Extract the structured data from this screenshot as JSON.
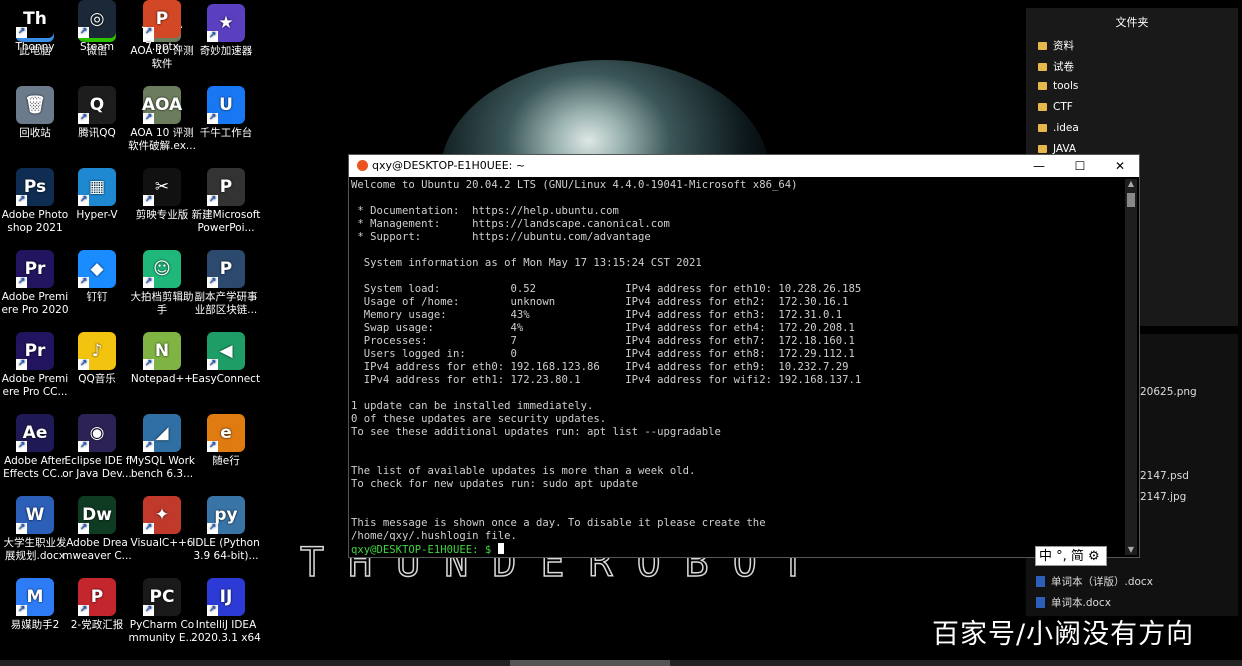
{
  "desktop": {
    "wallpaper_text": "THUNDEROBOT",
    "icons": [
      {
        "label": "此电脑",
        "glyph": "🖥",
        "color": "#3a8ee6"
      },
      {
        "label": "微信",
        "glyph": "●",
        "color": "#2dc100"
      },
      {
        "label": "AOA 10 评测软件",
        "glyph": "AOA",
        "color": "#6c7d5e"
      },
      {
        "label": "奇妙加速器",
        "glyph": "★",
        "color": "#5a3fc0"
      },
      {
        "label": "回收站",
        "glyph": "🗑",
        "color": "#6b7b8c"
      },
      {
        "label": "腾讯QQ",
        "glyph": "Q",
        "color": "#1d1d1d"
      },
      {
        "label": "AOA 10 评测软件破解.ex...",
        "glyph": "AOA",
        "color": "#6c7d5e"
      },
      {
        "label": "千牛工作台",
        "glyph": "U",
        "color": "#1877f2"
      },
      {
        "label": "Adobe Photoshop 2021",
        "glyph": "Ps",
        "color": "#0f2d52"
      },
      {
        "label": "Hyper-V",
        "glyph": "▦",
        "color": "#1e88d1"
      },
      {
        "label": "剪映专业版",
        "glyph": "✂",
        "color": "#111111"
      },
      {
        "label": "新建Microsoft PowerPoi...",
        "glyph": "P",
        "color": "#333333"
      },
      {
        "label": "Adobe Premiere Pro 2020",
        "glyph": "Pr",
        "color": "#22145e"
      },
      {
        "label": "钉钉",
        "glyph": "◆",
        "color": "#1a8cff"
      },
      {
        "label": "大拍档剪辑助手",
        "glyph": "☺",
        "color": "#1fb77a"
      },
      {
        "label": "副本产学研事业部区块链...",
        "glyph": "P",
        "color": "#2b4a6e"
      },
      {
        "label": "Adobe Premiere Pro CC...",
        "glyph": "Pr",
        "color": "#22145e"
      },
      {
        "label": "QQ音乐",
        "glyph": "♪",
        "color": "#f2c40f"
      },
      {
        "label": "Notepad++",
        "glyph": "N",
        "color": "#7fb343"
      },
      {
        "label": "EasyConnect",
        "glyph": "◀",
        "color": "#1e9e66"
      },
      {
        "label": "Adobe After Effects CC...",
        "glyph": "Ae",
        "color": "#1f1a55"
      },
      {
        "label": "Eclipse IDE for Java Dev...",
        "glyph": "◉",
        "color": "#2c2255"
      },
      {
        "label": "MySQL Workbench 6.3...",
        "glyph": "◢",
        "color": "#2f6fa3"
      },
      {
        "label": "随e行",
        "glyph": "e",
        "color": "#e07b12"
      },
      {
        "label": "大学生职业发展规划.docx",
        "glyph": "W",
        "color": "#2b5fb8"
      },
      {
        "label": "Adobe Dreamweaver C...",
        "glyph": "Dw",
        "color": "#0f3b22"
      },
      {
        "label": "VisualC++6",
        "glyph": "✦",
        "color": "#c0392b"
      },
      {
        "label": "IDLE (Python 3.9 64-bit)...",
        "glyph": "py",
        "color": "#3874a6"
      },
      {
        "label": "易媒助手2",
        "glyph": "M",
        "color": "#2d7cf6"
      },
      {
        "label": "2-党政汇报",
        "glyph": "P",
        "color": "#c4262e"
      },
      {
        "label": "PyCharm Community E...",
        "glyph": "PC",
        "color": "#1a1a1a"
      },
      {
        "label": "IntelliJ IDEA 2020.3.1 x64",
        "glyph": "IJ",
        "color": "#2d3bd6"
      },
      {
        "label": "Thonny",
        "glyph": "Th",
        "color": "#000000"
      },
      {
        "label": "Steam",
        "glyph": "◎",
        "color": "#1b2838"
      },
      {
        "label": "7.pptx",
        "glyph": "P",
        "color": "#d24726"
      }
    ]
  },
  "explorer": {
    "title": "文件夹",
    "folders": [
      "资料",
      "试卷",
      "tools",
      "CTF",
      ".idea",
      "JAVA"
    ],
    "files": [
      "20625.png",
      "2147.psd",
      "2147.jpg",
      "单词本（详版）.docx",
      "单词本.docx"
    ]
  },
  "terminal": {
    "title": "qxy@DESKTOP-E1H0UEE: ~",
    "lines": [
      "Welcome to Ubuntu 20.04.2 LTS (GNU/Linux 4.4.0-19041-Microsoft x86_64)",
      "",
      " * Documentation:  https://help.ubuntu.com",
      " * Management:     https://landscape.canonical.com",
      " * Support:        https://ubuntu.com/advantage",
      "",
      "  System information as of Mon May 17 13:15:24 CST 2021",
      "",
      "  System load:           0.52              IPv4 address for eth10: 10.228.26.185",
      "  Usage of /home:        unknown           IPv4 address for eth2:  172.30.16.1",
      "  Memory usage:          43%               IPv4 address for eth3:  172.31.0.1",
      "  Swap usage:            4%                IPv4 address for eth4:  172.20.208.1",
      "  Processes:             7                 IPv4 address for eth7:  172.18.160.1",
      "  Users logged in:       0                 IPv4 address for eth8:  172.29.112.1",
      "  IPv4 address for eth0: 192.168.123.86    IPv4 address for eth9:  10.232.7.29",
      "  IPv4 address for eth1: 172.23.80.1       IPv4 address for wifi2: 192.168.137.1",
      "",
      "1 update can be installed immediately.",
      "0 of these updates are security updates.",
      "To see these additional updates run: apt list --upgradable",
      "",
      "",
      "The list of available updates is more than a week old.",
      "To check for new updates run: sudo apt update",
      "",
      "",
      "This message is shown once a day. To disable it please create the",
      "/home/qxy/.hushlogin file."
    ],
    "prompt": "qxy@DESKTOP-E1H0UEE: $ ",
    "buttons": {
      "minimize": "—",
      "maximize": "☐",
      "close": "✕"
    }
  },
  "ime": {
    "text": "中 °, 简 ⚙"
  },
  "watermark": "百家号/小阙没有方向"
}
